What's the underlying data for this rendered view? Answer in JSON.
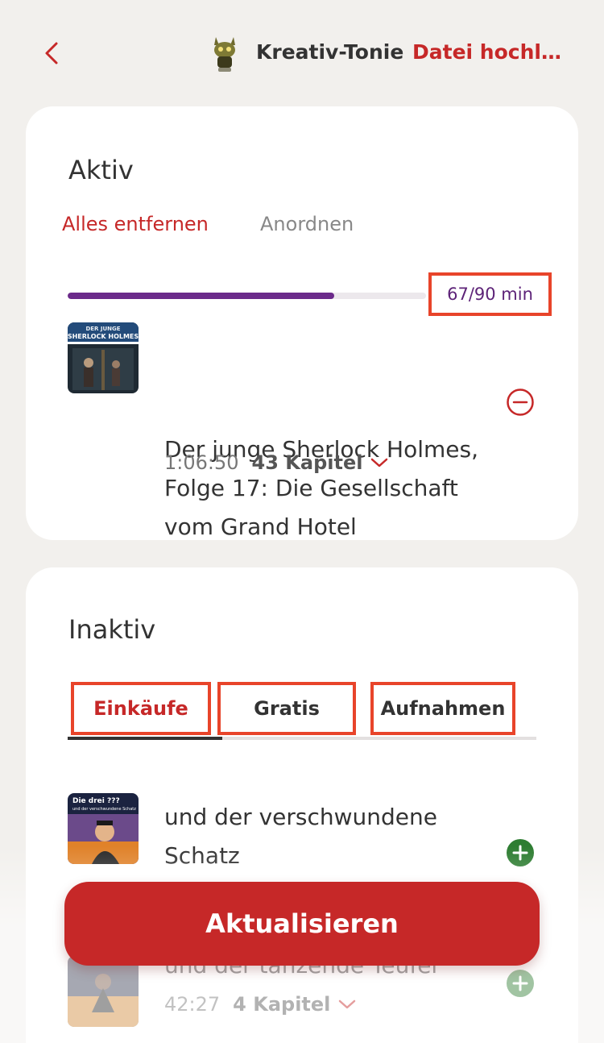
{
  "header": {
    "back_icon": "chevron-left-icon",
    "tonie_name": "Kreativ-Tonie",
    "upload_label": "Datei hochla..."
  },
  "active": {
    "title": "Aktiv",
    "remove_all_label": "Alles entfernen",
    "arrange_label": "Anordnen",
    "progress_label": "67/90 min",
    "progress_fraction": 0.744,
    "items": [
      {
        "title_lines": [
          "Der junge Sherlock Holmes,",
          "Folge 17: Die Gesellschaft",
          "vom Grand Hotel"
        ],
        "duration": "1:06:50",
        "chapters": "43 Kapitel",
        "cover_header": "DER JUNGE SHERLOCK HOLMES"
      }
    ]
  },
  "inactive": {
    "title": "Inaktiv",
    "tabs": [
      {
        "label": "Einkäufe",
        "active": true
      },
      {
        "label": "Gratis",
        "active": false
      },
      {
        "label": "Aufnahmen",
        "active": false
      }
    ],
    "items": [
      {
        "title_lines": [
          "und der verschwundene",
          "Schatz"
        ],
        "cover_header": "Die drei ???",
        "cover_sub": "und der verschwundene Schatz"
      },
      {
        "title_lines": [
          "und der tanzende Teufel"
        ],
        "duration": "42:27",
        "chapters": "4 Kapitel"
      }
    ]
  },
  "footer": {
    "update_label": "Aktualisieren"
  },
  "colors": {
    "accent_red": "#c62828",
    "progress_purple": "#6b2a8a",
    "add_green": "#2e7d32",
    "highlight_box": "#e8442a"
  }
}
